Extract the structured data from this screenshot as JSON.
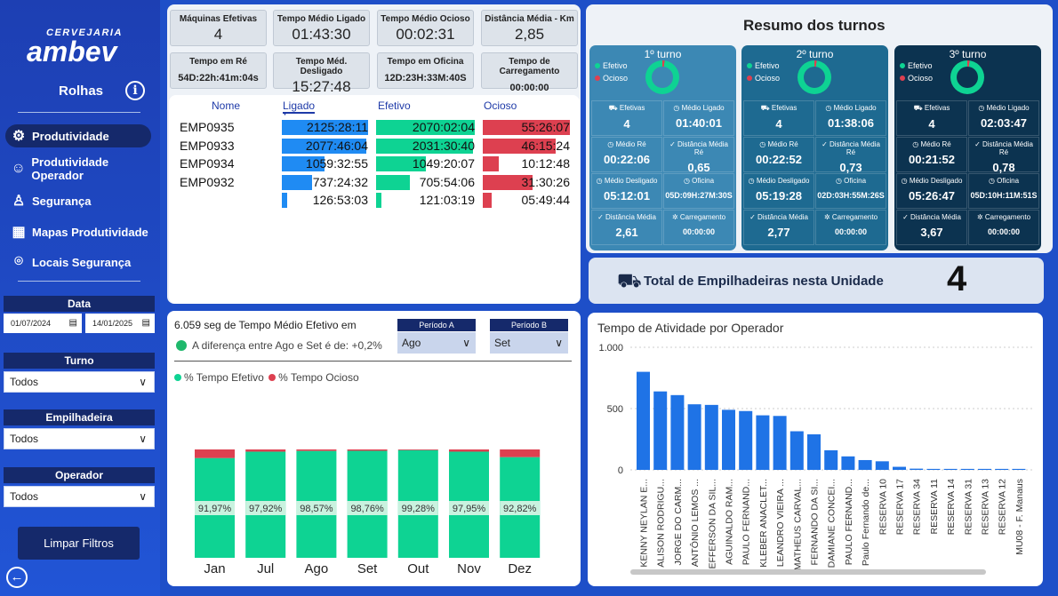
{
  "sidebar": {
    "brand_small": "CERVEJARIA",
    "brand": "ambev",
    "subtitle": "Rolhas",
    "nav": [
      {
        "label": "Produtividade",
        "icon": "gears-icon"
      },
      {
        "label": "Produtividade Operador",
        "icon": "users-icon"
      },
      {
        "label": "Segurança",
        "icon": "worker-icon"
      },
      {
        "label": "Mapas Produtividade",
        "icon": "map-icon"
      },
      {
        "label": "Locais Segurança",
        "icon": "pin-icon"
      }
    ],
    "filters": {
      "data_label": "Data",
      "date_start": "01/07/2024",
      "date_end": "14/01/2025",
      "turno_label": "Turno",
      "turno": "Todos",
      "empilhadeira_label": "Empilhadeira",
      "empilhadeira": "Todos",
      "operador_label": "Operador",
      "operador": "Todos"
    },
    "clear": "Limpar Filtros"
  },
  "kpis": [
    {
      "label": "Máquinas Efetivas",
      "value": "4"
    },
    {
      "label": "Tempo Médio Ligado",
      "value": "01:43:30"
    },
    {
      "label": "Tempo Médio Ocioso",
      "value": "00:02:31"
    },
    {
      "label": "Distância Média - Km",
      "value": "2,85"
    },
    {
      "label": "Tempo em Ré",
      "value": "54D:22h:41m:04s"
    },
    {
      "label": "Tempo Méd. Desligado",
      "value": "15:27:48"
    },
    {
      "label": "Tempo em Oficina",
      "value": "12D:23H:33M:40S"
    },
    {
      "label": "Tempo de Carregamento",
      "value": "00:00:00"
    }
  ],
  "table": {
    "headers": [
      "Nome",
      "Ligado",
      "Efetivo",
      "Ocioso"
    ],
    "rows": [
      {
        "nome": "EMP0935",
        "ligado": "2125:28:11",
        "ligado_v": 2125.47,
        "efetivo": "2070:02:04",
        "efetivo_v": 2070.03,
        "ocioso": "55:26:07",
        "ocioso_v": 55.44
      },
      {
        "nome": "EMP0933",
        "ligado": "2077:46:04",
        "ligado_v": 2077.77,
        "efetivo": "2031:30:40",
        "efetivo_v": 2031.51,
        "ocioso": "46:15:24",
        "ocioso_v": 46.26
      },
      {
        "nome": "EMP0934",
        "ligado": "1059:32:55",
        "ligado_v": 1059.55,
        "efetivo": "1049:20:07",
        "efetivo_v": 1049.34,
        "ocioso": "10:12:48",
        "ocioso_v": 10.21
      },
      {
        "nome": "EMP0932",
        "ligado": "737:24:32",
        "ligado_v": 737.41,
        "efetivo": "705:54:06",
        "efetivo_v": 705.9,
        "ocioso": "31:30:26",
        "ocioso_v": 31.51
      },
      {
        "nome": "",
        "ligado": "126:53:03",
        "ligado_v": 126.88,
        "efetivo": "121:03:19",
        "efetivo_v": 121.06,
        "ocioso": "05:49:44",
        "ocioso_v": 5.83
      }
    ]
  },
  "resumo": {
    "title": "Resumo dos turnos",
    "legend_efetivo": "Efetivo",
    "legend_ocioso": "Ocioso",
    "labels": [
      "Efetivas",
      "Médio Ligado",
      "Médio Ré",
      "Distância Média Ré",
      "Médio Desligado",
      "Oficina",
      "Distância Média",
      "Carregamento"
    ],
    "shifts": [
      {
        "title": "1º turno",
        "values": [
          "4",
          "01:40:01",
          "00:22:06",
          "0,65",
          "05:12:01",
          "05D:09H:27M:30S",
          "2,61",
          "00:00:00"
        ]
      },
      {
        "title": "2º turno",
        "values": [
          "4",
          "01:38:06",
          "00:22:52",
          "0,73",
          "05:19:28",
          "02D:03H:55M:26S",
          "2,77",
          "00:00:00"
        ]
      },
      {
        "title": "3º turno",
        "values": [
          "4",
          "02:03:47",
          "00:21:52",
          "0,78",
          "05:26:47",
          "05D:10H:11M:51S",
          "3,67",
          "00:00:00"
        ]
      }
    ]
  },
  "total": {
    "label": "Total de Empilhadeiras nesta Unidade",
    "value": "4"
  },
  "periodo": {
    "header": "6.059 seg de Tempo Médio Efetivo em",
    "diff": "A diferença entre Ago e Set é de: +0,2%",
    "a_label": "Período A",
    "a_value": "Ago",
    "b_label": "Período B",
    "b_value": "Set"
  },
  "colors": {
    "efetivo": "#0ed393",
    "ocioso": "#dd4050",
    "ligado": "#1f8bf3",
    "bar": "#1f73e6"
  },
  "chart_data": [
    {
      "type": "bar",
      "stacked": true,
      "legend": [
        "% Tempo Efetivo",
        "% Tempo Ocioso"
      ],
      "categories": [
        "Jan",
        "Jul",
        "Ago",
        "Set",
        "Out",
        "Nov",
        "Dez"
      ],
      "series": [
        {
          "name": "% Tempo Efetivo",
          "values": [
            91.97,
            97.92,
            98.57,
            98.76,
            99.28,
            97.95,
            92.82
          ]
        },
        {
          "name": "% Tempo Ocioso",
          "values": [
            8.03,
            2.08,
            1.43,
            1.24,
            0.72,
            2.05,
            7.18
          ]
        }
      ],
      "labels": [
        "91,97%",
        "97,92%",
        "98,57%",
        "98,76%",
        "99,28%",
        "97,95%",
        "92,82%"
      ],
      "ylim": [
        0,
        100
      ]
    },
    {
      "type": "bar",
      "title": "Tempo de Atividade por Operador",
      "categories": [
        "KENNY NEYLAN E...",
        "ALISON RODRIGU...",
        "JORGE DO CARM...",
        "ANTÔNIO LEMOS ...",
        "JEFFERSON DA SIL...",
        "AGUINALDO RAM...",
        "PAULO FERNAND...",
        "KLEBER ANACLET...",
        "LEANDRO VIEIRA ...",
        "MATHEUS CARVAL...",
        "FERNANDO DA SI...",
        "DAMIANE CONCEI...",
        "PAULO FERNAND...",
        "Paulo Fernando de...",
        "RESERVA 10",
        "RESERVA 17",
        "RESERVA 34",
        "RESERVA 11",
        "RESERVA 14",
        "RESERVA 31",
        "RESERVA 13",
        "RESERVA 12",
        "MU08 - F. Manaus"
      ],
      "values": [
        800,
        640,
        610,
        535,
        530,
        490,
        480,
        445,
        440,
        315,
        290,
        160,
        110,
        80,
        70,
        25,
        10,
        8,
        8,
        8,
        8,
        8,
        8
      ],
      "yticks": [
        "0",
        "500",
        "1.000"
      ],
      "ylim": [
        0,
        1000
      ]
    }
  ]
}
